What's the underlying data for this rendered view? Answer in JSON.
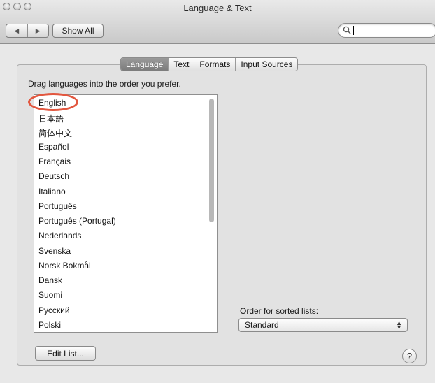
{
  "window": {
    "title": "Language & Text"
  },
  "toolbar": {
    "back_glyph": "◀",
    "forward_glyph": "▶",
    "show_all_label": "Show All",
    "search_value": "",
    "search_placeholder": ""
  },
  "tabs": [
    {
      "label": "Language",
      "active": true
    },
    {
      "label": "Text",
      "active": false
    },
    {
      "label": "Formats",
      "active": false
    },
    {
      "label": "Input Sources",
      "active": false
    }
  ],
  "language_pane": {
    "instruction": "Drag languages into the order you prefer.",
    "languages": [
      "English",
      "日本語",
      "简体中文",
      "Español",
      "Français",
      "Deutsch",
      "Italiano",
      "Português",
      "Português (Portugal)",
      "Nederlands",
      "Svenska",
      "Norsk Bokmål",
      "Dansk",
      "Suomi",
      "Русский",
      "Polski"
    ],
    "edit_list_label": "Edit List...",
    "sort_order_label": "Order for sorted lists:",
    "sort_order_value": "Standard",
    "help_label": "?"
  },
  "colors": {
    "highlight_ring": "#e2573f",
    "active_tab": "#858585"
  }
}
